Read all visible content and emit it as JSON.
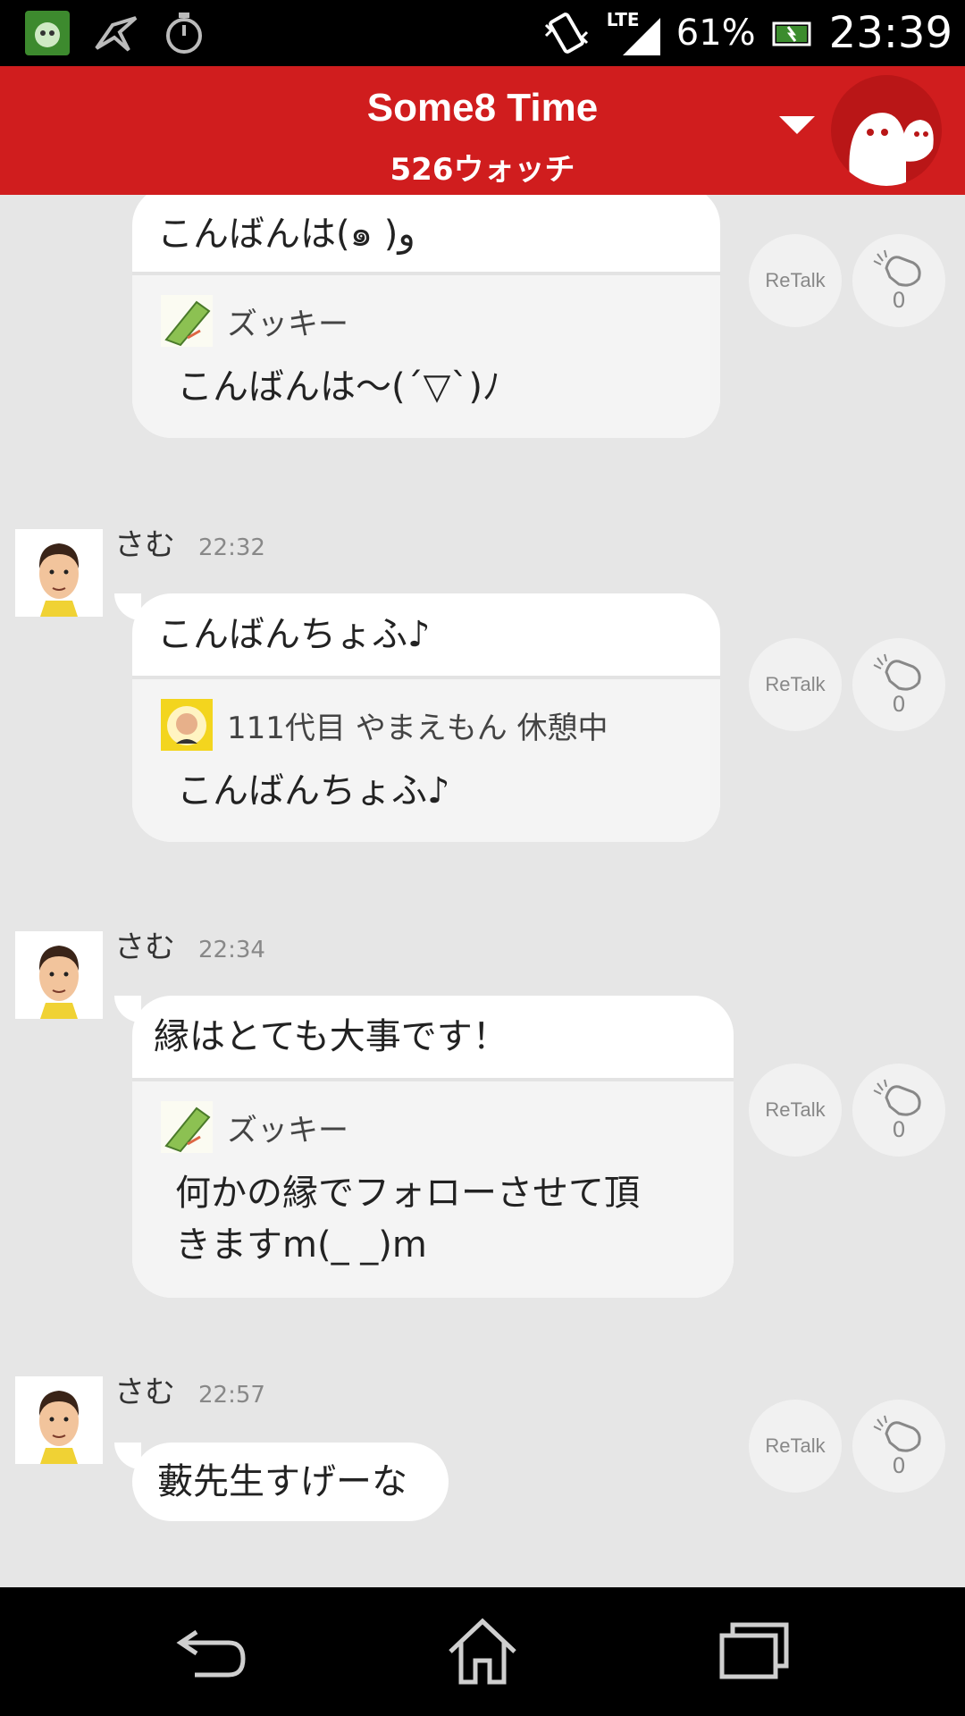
{
  "status_bar": {
    "battery": "61%",
    "clock": "23:39",
    "network": "LTE",
    "icons": [
      "app-notification-icon",
      "origami-crane-icon",
      "stopwatch-icon",
      "vibrate-icon",
      "signal-icon",
      "battery-charging-icon"
    ]
  },
  "header": {
    "title": "Some8 Time",
    "subtitle": "526ウォッチ",
    "dropdown_icon": "triangle-down-icon",
    "mascot_icon": "ghost-mascot-icon",
    "color": "#d01d1e"
  },
  "posts": [
    {
      "message": "こんばんは(๑ )و",
      "quote": {
        "name": "ズッキー",
        "text": "こんばんは〜(´▽`)ﾉ"
      },
      "retalk": "ReTalk",
      "clap_count": "0"
    },
    {
      "user": "さむ",
      "time": "22:32",
      "message": "こんばんちょふ♪",
      "quote": {
        "name": "111代目 やまえもん 休憩中",
        "text": "こんばんちょふ♪"
      },
      "retalk": "ReTalk",
      "clap_count": "0"
    },
    {
      "user": "さむ",
      "time": "22:34",
      "message": "縁はとても大事です！",
      "quote": {
        "name": "ズッキー",
        "text_line1": "何かの縁でフォローさせて頂",
        "text_line2": "きますm(_ _)m"
      },
      "retalk": "ReTalk",
      "clap_count": "0"
    },
    {
      "user": "さむ",
      "time": "22:57",
      "message": "藪先生すげーな",
      "retalk": "ReTalk",
      "clap_count": "0"
    }
  ],
  "nav": {
    "icons": [
      "back-icon",
      "home-icon",
      "recents-icon"
    ]
  }
}
